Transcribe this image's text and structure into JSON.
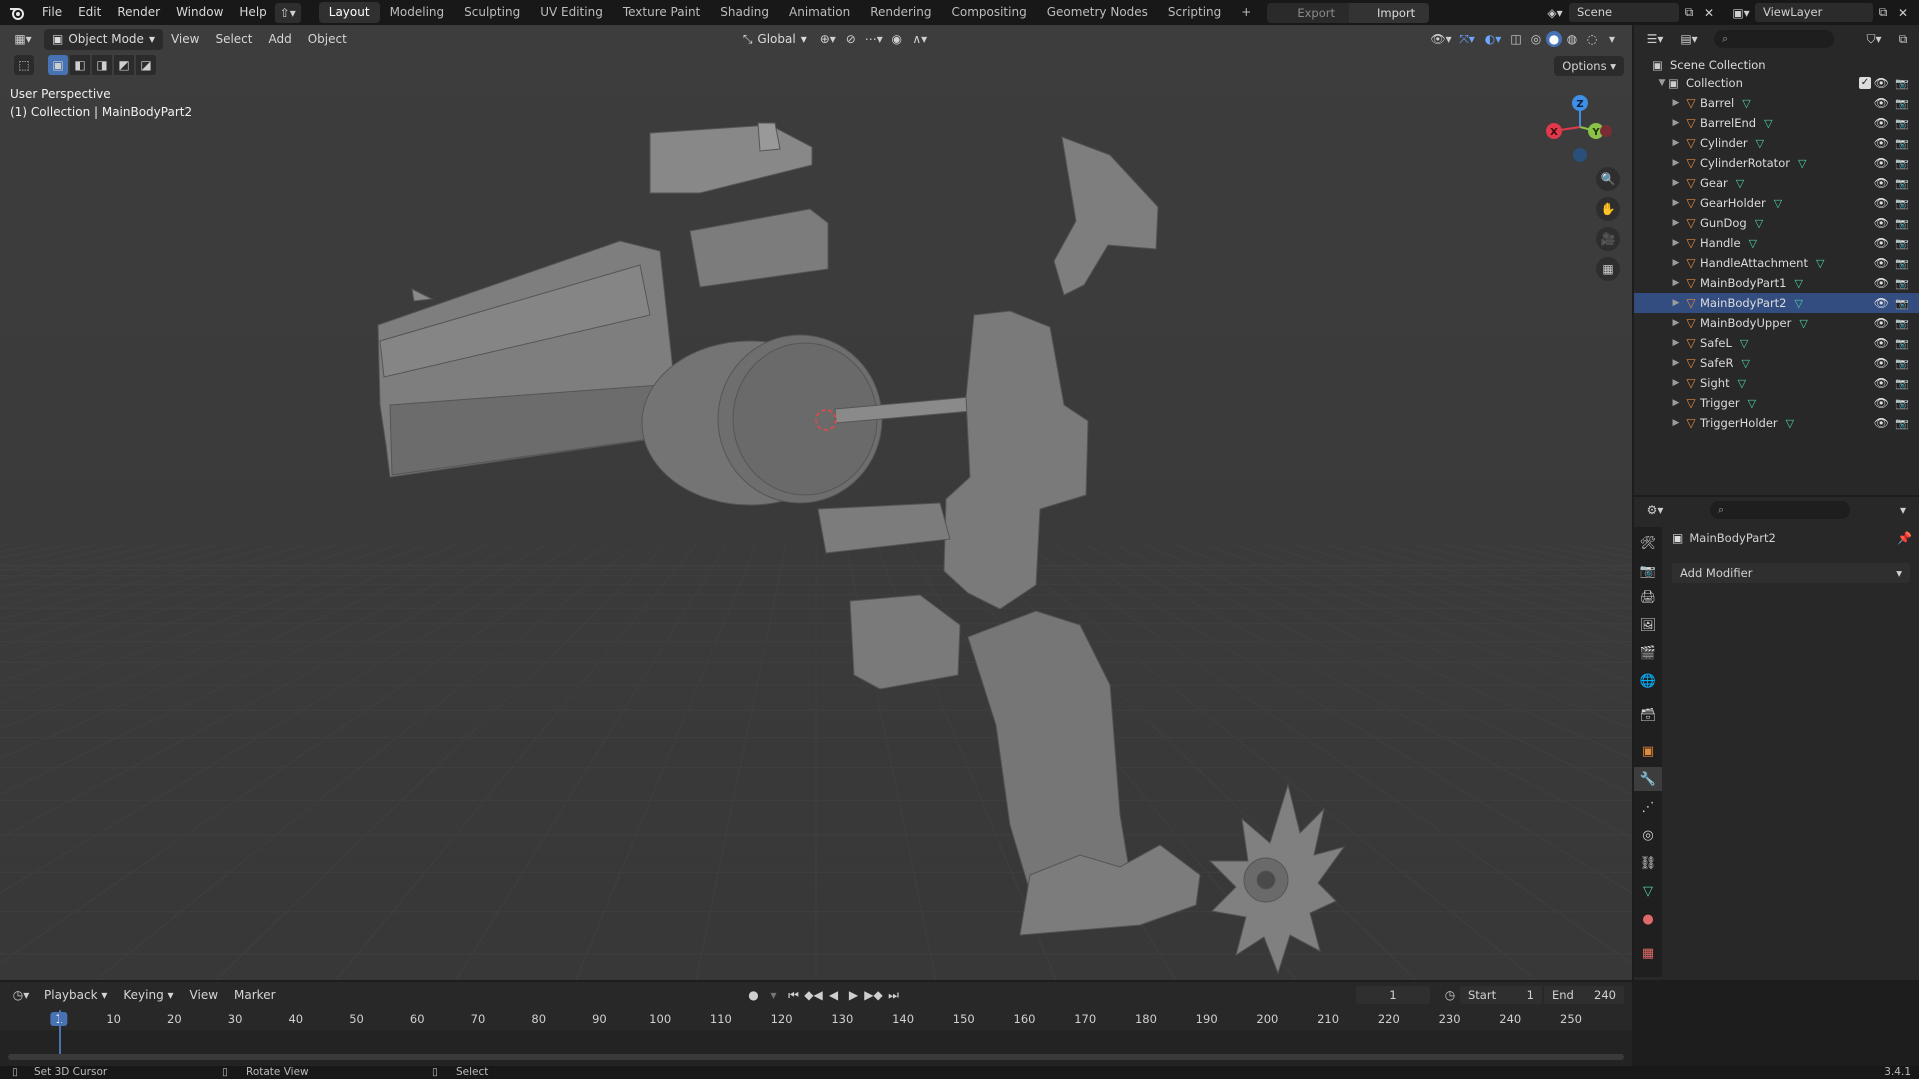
{
  "menubar": {
    "logo_icon": "blender-logo-icon",
    "menus": [
      "File",
      "Edit",
      "Render",
      "Window",
      "Help"
    ],
    "workspaces": [
      "Layout",
      "Modeling",
      "Sculpting",
      "UV Editing",
      "Texture Paint",
      "Shading",
      "Animation",
      "Rendering",
      "Compositing",
      "Geometry Nodes",
      "Scripting"
    ],
    "active_workspace": "Layout",
    "add_workspace": "+",
    "export_label": "Export",
    "import_label": "Import",
    "scene_label": "Scene",
    "viewlayer_label": "ViewLayer"
  },
  "viewport": {
    "mode_label": "Object Mode",
    "menus": [
      "View",
      "Select",
      "Add",
      "Object"
    ],
    "orientation_label": "Global",
    "options_label": "Options",
    "overlay_line1": "User Perspective",
    "overlay_line2": "(1) Collection | MainBodyPart2",
    "gizmo": {
      "x": "X",
      "y": "Y",
      "z": "Z"
    }
  },
  "outliner": {
    "scene_collection": "Scene Collection",
    "collection": "Collection",
    "objects": [
      {
        "name": "Barrel",
        "selected": false
      },
      {
        "name": "BarrelEnd",
        "selected": false
      },
      {
        "name": "Cylinder",
        "selected": false
      },
      {
        "name": "CylinderRotator",
        "selected": false
      },
      {
        "name": "Gear",
        "selected": false
      },
      {
        "name": "GearHolder",
        "selected": false
      },
      {
        "name": "GunDog",
        "selected": false
      },
      {
        "name": "Handle",
        "selected": false
      },
      {
        "name": "HandleAttachment",
        "selected": false
      },
      {
        "name": "MainBodyPart1",
        "selected": false
      },
      {
        "name": "MainBodyPart2",
        "selected": true
      },
      {
        "name": "MainBodyUpper",
        "selected": false
      },
      {
        "name": "SafeL",
        "selected": false
      },
      {
        "name": "SafeR",
        "selected": false
      },
      {
        "name": "Sight",
        "selected": false
      },
      {
        "name": "Trigger",
        "selected": false
      },
      {
        "name": "TriggerHolder",
        "selected": false
      }
    ]
  },
  "properties": {
    "object_name": "MainBodyPart2",
    "add_modifier_label": "Add Modifier"
  },
  "timeline": {
    "menus": [
      "Playback",
      "Keying",
      "View",
      "Marker"
    ],
    "current_frame": "1",
    "start_label": "Start",
    "start_value": "1",
    "end_label": "End",
    "end_value": "240",
    "ticks": [
      "1",
      "10",
      "20",
      "30",
      "40",
      "50",
      "60",
      "70",
      "80",
      "90",
      "100",
      "110",
      "120",
      "130",
      "140",
      "150",
      "160",
      "170",
      "180",
      "190",
      "200",
      "210",
      "220",
      "230",
      "240",
      "250"
    ]
  },
  "statusbar": {
    "left_action": "Set 3D Cursor",
    "middle_action": "Rotate View",
    "right_action": "Select",
    "version": "3.4.1"
  },
  "colors": {
    "accent_blue": "#4772b3",
    "selection": "#334d80",
    "mesh_orange": "#e08a3a",
    "data_green": "#4fd0a0",
    "axis_x": "#e0394b",
    "axis_y": "#8bc34a",
    "axis_z": "#3f8fe8"
  }
}
